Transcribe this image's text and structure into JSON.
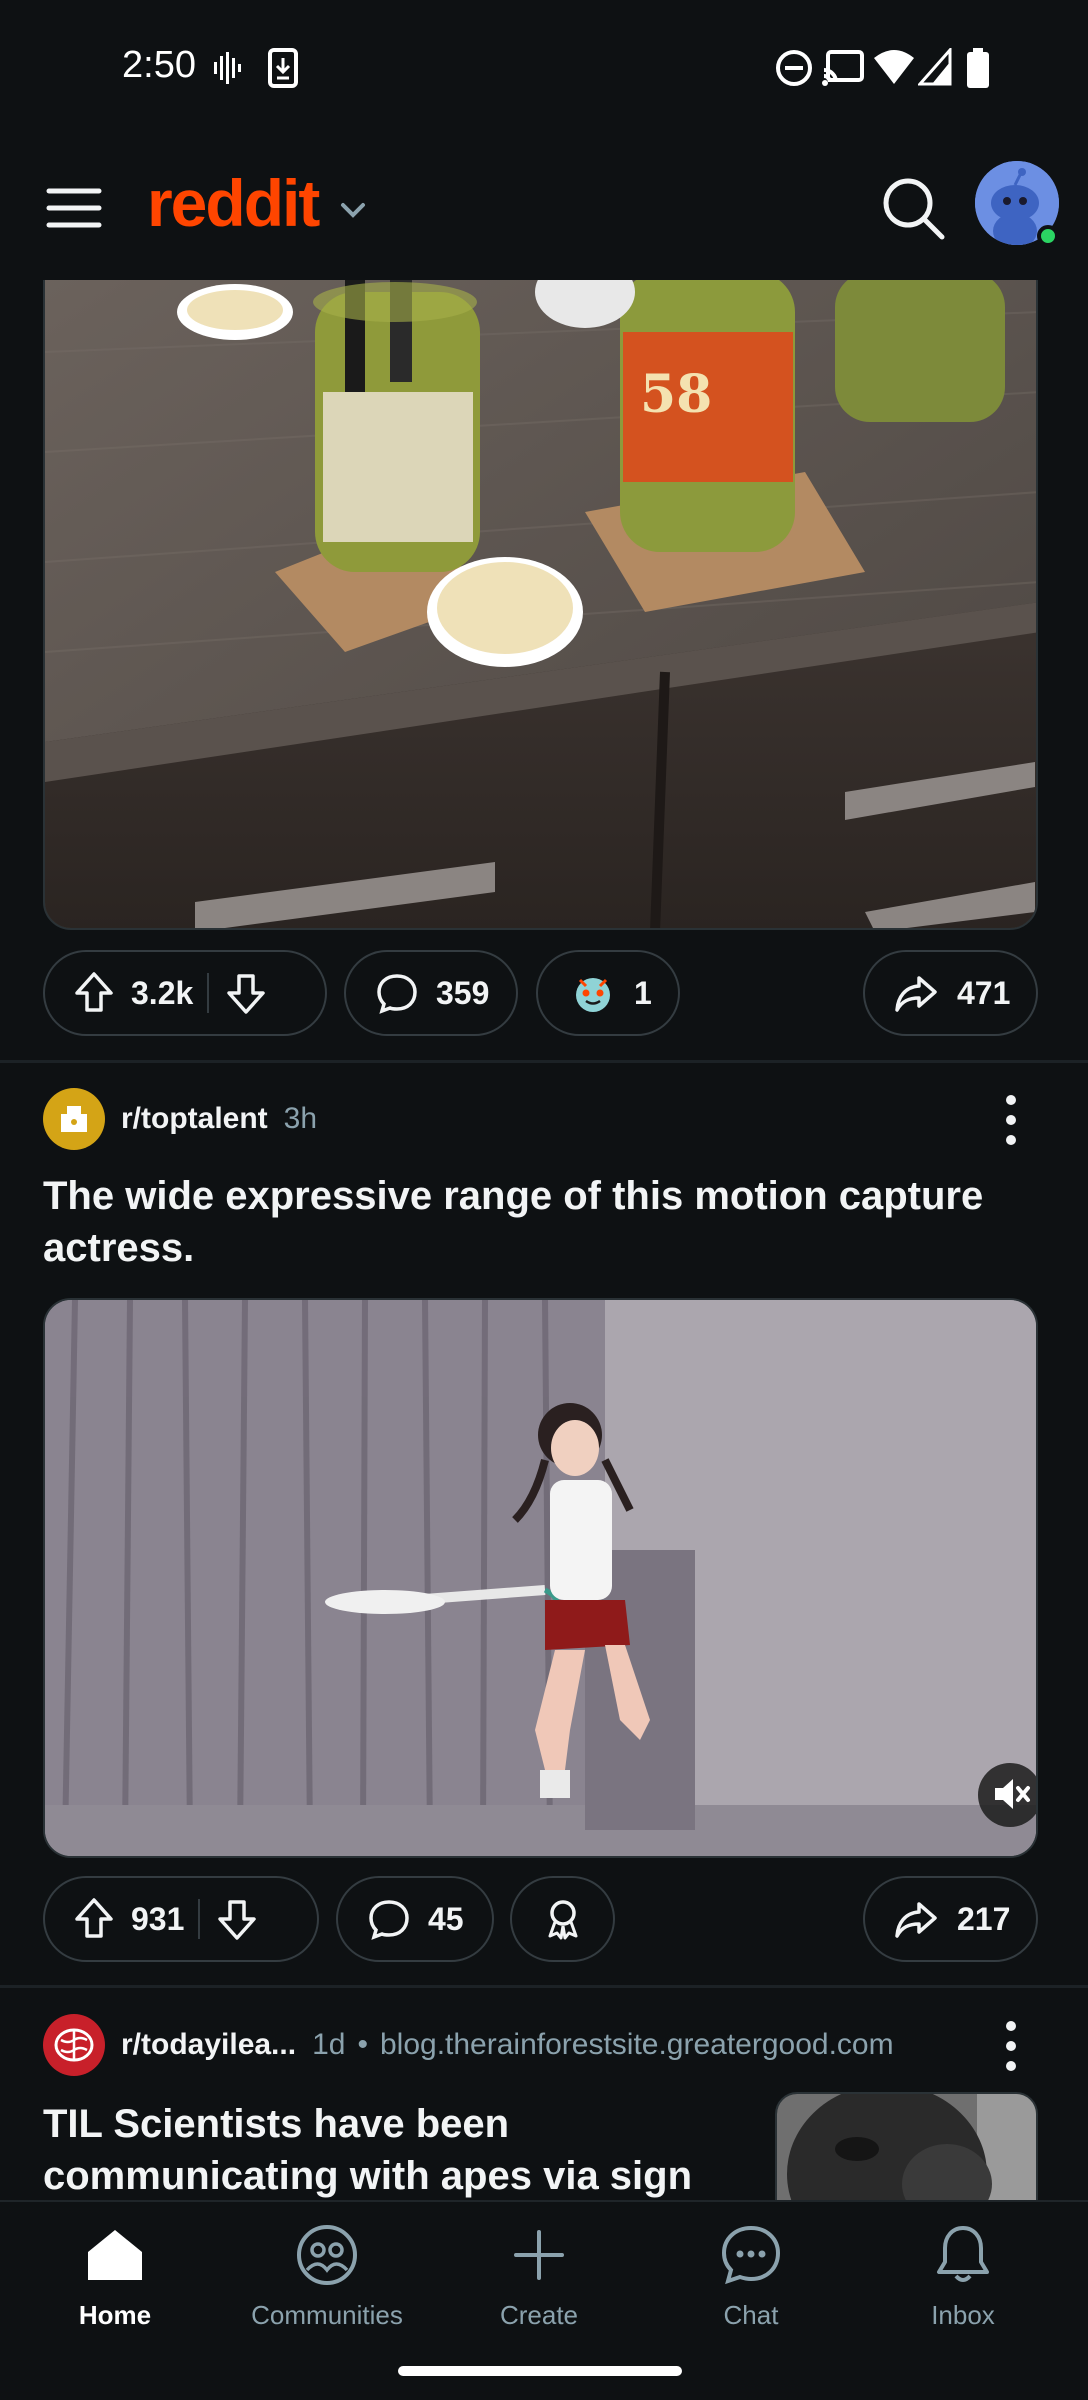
{
  "status_bar": {
    "time": "2:50",
    "icons": [
      "voicemail-icon",
      "download-icon",
      "dnd-icon",
      "cast-icon",
      "wifi-icon",
      "signal-icon",
      "battery-icon"
    ]
  },
  "header": {
    "logo": "reddit",
    "icons": [
      "menu-icon",
      "chevron-down-icon",
      "search-icon",
      "avatar"
    ]
  },
  "posts": [
    {
      "media_type": "image",
      "upvotes": "3.2k",
      "comments": "359",
      "awards": "1",
      "shares": "471"
    },
    {
      "subreddit": "r/toptalent",
      "age": "3h",
      "title": "The wide expressive range of this motion capture actress.",
      "media_type": "video",
      "upvotes": "931",
      "comments": "45",
      "shares": "217"
    },
    {
      "subreddit": "r/todayilea...",
      "age": "1d",
      "separator": "•",
      "domain": "blog.therainforestsite.greatergood.com",
      "title": "TIL Scientists have been communicating with apes via sign"
    }
  ],
  "bottom_nav": [
    {
      "label": "Home",
      "icon": "home-icon",
      "active": true
    },
    {
      "label": "Communities",
      "icon": "communities-icon",
      "active": false
    },
    {
      "label": "Create",
      "icon": "plus-icon",
      "active": false
    },
    {
      "label": "Chat",
      "icon": "chat-icon",
      "active": false
    },
    {
      "label": "Inbox",
      "icon": "bell-icon",
      "active": false
    }
  ],
  "colors": {
    "background": "#0e1113",
    "brand": "#ff4500",
    "text": "#f2f4f5",
    "muted": "#8ba2ad",
    "online": "#2bd563"
  }
}
